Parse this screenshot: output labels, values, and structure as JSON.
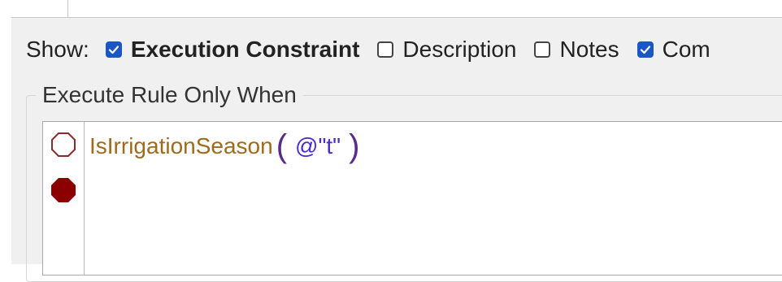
{
  "show": {
    "label": "Show:",
    "options": [
      {
        "label": "Execution Constraint",
        "checked": true,
        "bold": true
      },
      {
        "label": "Description",
        "checked": false
      },
      {
        "label": "Notes",
        "checked": false
      },
      {
        "label": "Com",
        "checked": true
      }
    ]
  },
  "group": {
    "legend": "Execute Rule Only When"
  },
  "editor": {
    "function_name": "IsIrrigationSeason",
    "open_paren": "(",
    "argument": "@\"t\"",
    "close_paren": ")"
  },
  "colors": {
    "checkbox_checked": "#1a56c4",
    "function": "#a06a1c",
    "argument": "#4a2bd0",
    "paren": "#5a2b8c",
    "breakpoint": "#8b0000"
  },
  "icons": [
    "check-icon",
    "breakpoint-outline-icon",
    "breakpoint-filled-icon"
  ]
}
